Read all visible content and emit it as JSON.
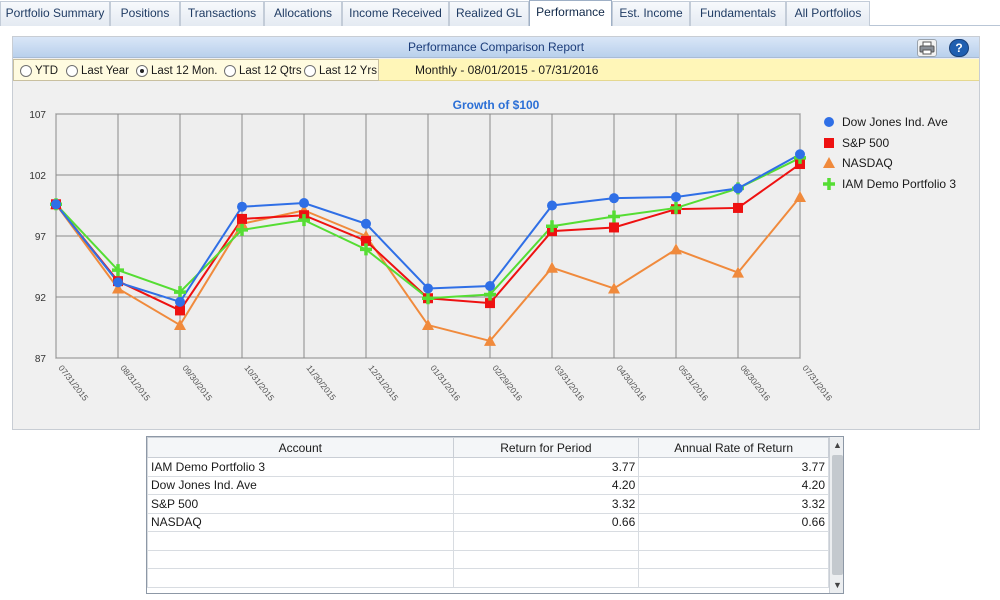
{
  "tabs": [
    {
      "label": "Portfolio Summary",
      "active": false
    },
    {
      "label": "Positions",
      "active": false
    },
    {
      "label": "Transactions",
      "active": false
    },
    {
      "label": "Allocations",
      "active": false
    },
    {
      "label": "Income Received",
      "active": false
    },
    {
      "label": "Realized GL",
      "active": false
    },
    {
      "label": "Performance",
      "active": true
    },
    {
      "label": "Est. Income",
      "active": false
    },
    {
      "label": "Fundamentals",
      "active": false
    },
    {
      "label": "All Portfolios",
      "active": false
    }
  ],
  "report": {
    "title": "Performance Comparison Report",
    "print_icon": "printer-icon",
    "help_icon": "help-icon",
    "help_glyph": "?",
    "options": [
      {
        "label": "YTD",
        "selected": false
      },
      {
        "label": "Last Year",
        "selected": false
      },
      {
        "label": "Last 12 Mon.",
        "selected": true
      },
      {
        "label": "Last 12 Qtrs",
        "selected": false
      },
      {
        "label": "Last 12 Yrs",
        "selected": false
      }
    ],
    "period": "Monthly - 08/01/2015 - 07/31/2016"
  },
  "chart_data": {
    "type": "line",
    "title": "Growth of $100",
    "categories": [
      "07/31/2015",
      "08/31/2015",
      "09/30/2015",
      "10/31/2015",
      "11/30/2015",
      "12/31/2015",
      "01/31/2016",
      "02/29/2016",
      "03/31/2016",
      "04/30/2016",
      "05/31/2016",
      "06/30/2016",
      "07/31/2016"
    ],
    "ylim": [
      87,
      107
    ],
    "yticks": [
      87,
      92,
      97,
      102,
      107
    ],
    "grid": true,
    "legend_position": "right",
    "series": [
      {
        "name": "Dow Jones Ind. Ave",
        "color": "#2f6fe6",
        "marker": "circle",
        "values": [
          99.6,
          93.2,
          91.6,
          99.4,
          99.7,
          98.0,
          92.7,
          92.9,
          99.5,
          100.1,
          100.2,
          100.9,
          103.7
        ]
      },
      {
        "name": "S&P 500",
        "color": "#ee1111",
        "marker": "square",
        "values": [
          99.6,
          93.3,
          90.9,
          98.4,
          98.7,
          96.6,
          91.9,
          91.5,
          97.4,
          97.7,
          99.2,
          99.3,
          102.9
        ]
      },
      {
        "name": "NASDAQ",
        "color": "#f08a3c",
        "marker": "triangle",
        "values": [
          99.6,
          92.7,
          89.7,
          98.0,
          99.1,
          97.0,
          89.7,
          88.4,
          94.4,
          92.7,
          95.9,
          94.0,
          100.2
        ]
      },
      {
        "name": "IAM Demo Portfolio 3",
        "color": "#55dd33",
        "marker": "plus",
        "values": [
          99.6,
          94.2,
          92.4,
          97.5,
          98.3,
          95.9,
          91.9,
          92.2,
          97.8,
          98.6,
          99.3,
          100.9,
          103.4
        ]
      }
    ]
  },
  "table": {
    "headers": [
      "Account",
      "Return for Period",
      "Annual Rate of Return"
    ],
    "rows": [
      [
        "IAM Demo Portfolio 3",
        "3.77",
        "3.77"
      ],
      [
        "Dow Jones Ind. Ave",
        "4.20",
        "4.20"
      ],
      [
        "S&P 500",
        "3.32",
        "3.32"
      ],
      [
        "NASDAQ",
        "0.66",
        "0.66"
      ],
      [
        "",
        "",
        ""
      ],
      [
        "",
        "",
        ""
      ],
      [
        "",
        "",
        ""
      ]
    ],
    "scroll_up": "▲",
    "scroll_down": "▼"
  }
}
